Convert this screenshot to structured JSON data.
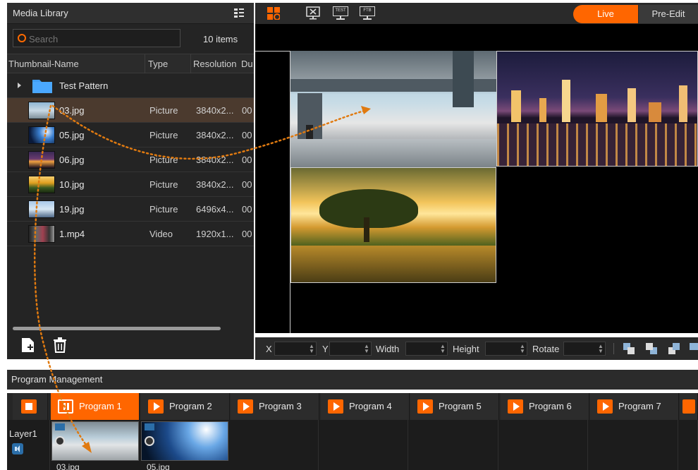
{
  "media_library": {
    "title": "Media Library",
    "search_placeholder": "Search",
    "item_count": "10 items",
    "columns": [
      "Thumbnail-Name",
      "Type",
      "Resolution",
      "Du"
    ],
    "folder": "Test Pattern",
    "items": [
      {
        "name": "03.jpg",
        "type": "Picture",
        "resolution": "3840x2...",
        "duration": "00"
      },
      {
        "name": "05.jpg",
        "type": "Picture",
        "resolution": "3840x2...",
        "duration": "00"
      },
      {
        "name": "06.jpg",
        "type": "Picture",
        "resolution": "3840x2...",
        "duration": "00"
      },
      {
        "name": "10.jpg",
        "type": "Picture",
        "resolution": "3840x2...",
        "duration": "00"
      },
      {
        "name": "19.jpg",
        "type": "Picture",
        "resolution": "6496x4...",
        "duration": "00"
      },
      {
        "name": "1.mp4",
        "type": "Video",
        "resolution": "1920x1...",
        "duration": "00"
      }
    ]
  },
  "toolbar": {
    "icons": [
      "layout-icon",
      "close-screen-icon",
      "test-icon",
      "ftb-icon"
    ],
    "test_label": "TEST",
    "ftb_label": "FTB",
    "live": "Live",
    "pre_edit": "Pre-Edit"
  },
  "properties": {
    "x": "X",
    "y": "Y",
    "width": "Width",
    "height": "Height",
    "rotate": "Rotate"
  },
  "program_management": {
    "title": "Program Management",
    "programs": [
      "Program 1",
      "Program 2",
      "Program 3",
      "Program 4",
      "Program 5",
      "Program 6",
      "Program 7"
    ],
    "layer": "Layer1",
    "clips": [
      "03.jpg",
      "05.jpg"
    ]
  },
  "colors": {
    "accent": "#ff6600",
    "panel": "#242424",
    "selected_row": "#4b3a2e",
    "arrow": "#e07a10"
  }
}
